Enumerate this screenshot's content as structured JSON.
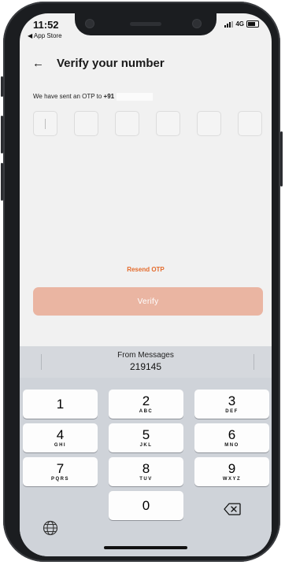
{
  "status_bar": {
    "time": "11:52",
    "back_app": "◀ App Store",
    "network": "4G"
  },
  "header": {
    "back_icon": "←",
    "title": "Verify your number"
  },
  "otp": {
    "sent_text": "We have sent an OTP to ",
    "country_code": "+91",
    "box_count": 6
  },
  "resend_label": "Resend OTP",
  "verify_label": "Verify",
  "keyboard": {
    "suggestion_label": "From Messages",
    "suggestion_code": "219145",
    "keys": [
      {
        "digit": "1",
        "letters": ""
      },
      {
        "digit": "2",
        "letters": "ABC"
      },
      {
        "digit": "3",
        "letters": "DEF"
      },
      {
        "digit": "4",
        "letters": "GHI"
      },
      {
        "digit": "5",
        "letters": "JKL"
      },
      {
        "digit": "6",
        "letters": "MNO"
      },
      {
        "digit": "7",
        "letters": "PQRS"
      },
      {
        "digit": "8",
        "letters": "TUV"
      },
      {
        "digit": "9",
        "letters": "WXYZ"
      },
      {
        "digit": "0",
        "letters": ""
      }
    ]
  },
  "colors": {
    "accent": "#e46b2c",
    "button_disabled": "#eab5a2",
    "keyboard_bg": "#cfd3d9"
  },
  "icons": [
    "back-arrow-icon",
    "signal-icon",
    "battery-icon",
    "globe-icon",
    "delete-icon"
  ]
}
